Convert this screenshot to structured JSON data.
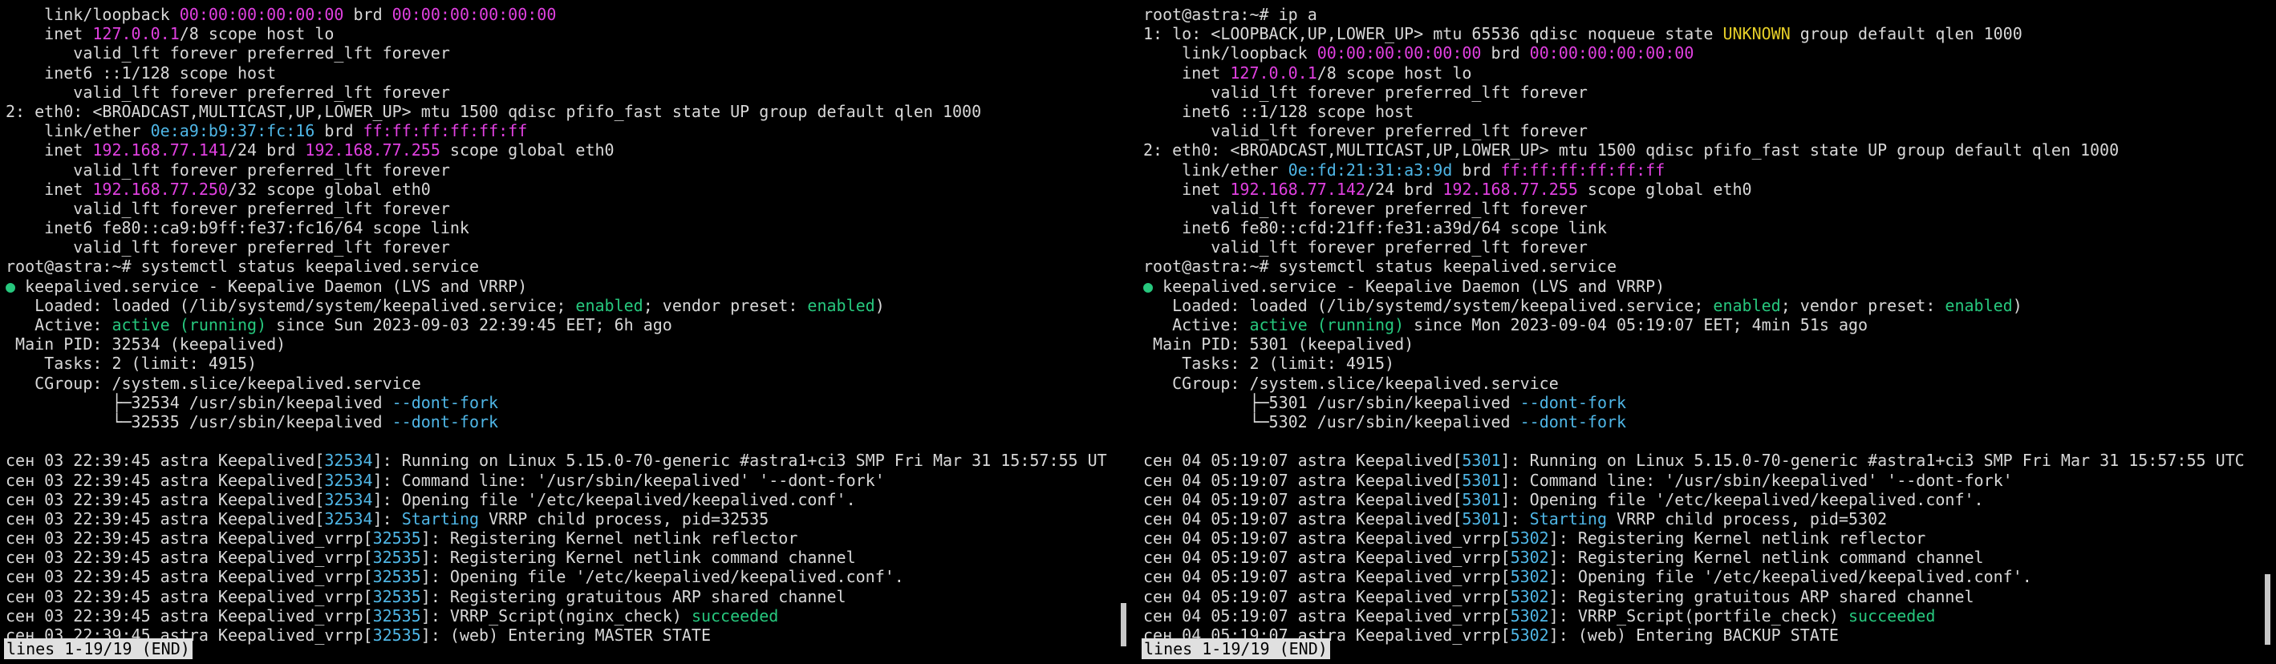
{
  "colors": {
    "magenta": "#e040e0",
    "cyan": "#4fb6e6",
    "green": "#27c87e",
    "yellow": "#e6cf28",
    "status_bg": "#e0e0e0",
    "background": "#000000"
  },
  "panes": [
    {
      "lines": [
        [
          [
            "    link/loopback ",
            ""
          ],
          [
            "00:00:00:00:00:00",
            "mag"
          ],
          [
            " brd ",
            ""
          ],
          [
            "00:00:00:00:00:00",
            "mag"
          ]
        ],
        [
          [
            "    inet ",
            ""
          ],
          [
            "127.0.0.1",
            "mag"
          ],
          [
            "/8 scope host lo",
            ""
          ]
        ],
        [
          [
            "       valid_lft forever preferred_lft forever",
            ""
          ]
        ],
        [
          [
            "    inet6 ::1/128 scope host",
            ""
          ]
        ],
        [
          [
            "       valid_lft forever preferred_lft forever",
            ""
          ]
        ],
        [
          [
            "2: eth0: <BROADCAST,MULTICAST,UP,LOWER_UP> mtu 1500 qdisc pfifo_fast state UP group default qlen 1000",
            ""
          ]
        ],
        [
          [
            "    link/ether ",
            ""
          ],
          [
            "0e:a9:b9:37:fc:16",
            "cyan"
          ],
          [
            " brd ",
            ""
          ],
          [
            "ff:ff:ff:ff:ff:ff",
            "mag"
          ]
        ],
        [
          [
            "    inet ",
            ""
          ],
          [
            "192.168.77.141",
            "mag"
          ],
          [
            "/24 brd ",
            ""
          ],
          [
            "192.168.77.255",
            "mag"
          ],
          [
            " scope global eth0",
            ""
          ]
        ],
        [
          [
            "       valid_lft forever preferred_lft forever",
            ""
          ]
        ],
        [
          [
            "    inet ",
            ""
          ],
          [
            "192.168.77.250",
            "mag"
          ],
          [
            "/32 scope global eth0",
            ""
          ]
        ],
        [
          [
            "       valid_lft forever preferred_lft forever",
            ""
          ]
        ],
        [
          [
            "    inet6 fe80::ca9:b9ff:fe37:fc16/64 scope link",
            ""
          ]
        ],
        [
          [
            "       valid_lft forever preferred_lft forever",
            ""
          ]
        ],
        [
          [
            "root@astra:~# systemctl status keepalived.service",
            ""
          ]
        ],
        [
          [
            "●",
            "grn"
          ],
          [
            " keepalived.service - Keepalive Daemon (LVS and VRRP)",
            ""
          ]
        ],
        [
          [
            "   Loaded: loaded (/lib/systemd/system/keepalived.service; ",
            ""
          ],
          [
            "enabled",
            "grn"
          ],
          [
            "; vendor preset: ",
            ""
          ],
          [
            "enabled",
            "grn"
          ],
          [
            ")",
            ""
          ]
        ],
        [
          [
            "   Active: ",
            ""
          ],
          [
            "active (running)",
            "grn"
          ],
          [
            " since Sun 2023-09-03 22:39:45 EET; 6h ago",
            ""
          ]
        ],
        [
          [
            " Main PID: 32534 (keepalived)",
            ""
          ]
        ],
        [
          [
            "    Tasks: 2 (limit: 4915)",
            ""
          ]
        ],
        [
          [
            "   CGroup: /system.slice/keepalived.service",
            ""
          ]
        ],
        [
          [
            "           ├─32534 /usr/sbin/keepalived ",
            ""
          ],
          [
            "--dont-fork",
            "cyan"
          ]
        ],
        [
          [
            "           └─32535 /usr/sbin/keepalived ",
            ""
          ],
          [
            "--dont-fork",
            "cyan"
          ]
        ],
        [],
        [
          [
            "сен 03 22:39:45 astra Keepalived[",
            ""
          ],
          [
            "32534",
            "cyan"
          ],
          [
            "]: Running on Linux 5.15.0-70-generic #astra1+ci3 SMP Fri Mar 31 15:57:55 UT",
            ""
          ]
        ],
        [
          [
            "сен 03 22:39:45 astra Keepalived[",
            ""
          ],
          [
            "32534",
            "cyan"
          ],
          [
            "]: Command line: '/usr/sbin/keepalived' '--dont-fork'",
            ""
          ]
        ],
        [
          [
            "сен 03 22:39:45 astra Keepalived[",
            ""
          ],
          [
            "32534",
            "cyan"
          ],
          [
            "]: Opening file '/etc/keepalived/keepalived.conf'.",
            ""
          ]
        ],
        [
          [
            "сен 03 22:39:45 astra Keepalived[",
            ""
          ],
          [
            "32534",
            "cyan"
          ],
          [
            "]: ",
            ""
          ],
          [
            "Starting",
            "cyan"
          ],
          [
            " VRRP child process, pid=32535",
            ""
          ]
        ],
        [
          [
            "сен 03 22:39:45 astra Keepalived_vrrp[",
            ""
          ],
          [
            "32535",
            "cyan"
          ],
          [
            "]: Registering Kernel netlink reflector",
            ""
          ]
        ],
        [
          [
            "сен 03 22:39:45 astra Keepalived_vrrp[",
            ""
          ],
          [
            "32535",
            "cyan"
          ],
          [
            "]: Registering Kernel netlink command channel",
            ""
          ]
        ],
        [
          [
            "сен 03 22:39:45 astra Keepalived_vrrp[",
            ""
          ],
          [
            "32535",
            "cyan"
          ],
          [
            "]: Opening file '/etc/keepalived/keepalived.conf'.",
            ""
          ]
        ],
        [
          [
            "сен 03 22:39:45 astra Keepalived_vrrp[",
            ""
          ],
          [
            "32535",
            "cyan"
          ],
          [
            "]: Registering gratuitous ARP shared channel",
            ""
          ]
        ],
        [
          [
            "сен 03 22:39:45 astra Keepalived_vrrp[",
            ""
          ],
          [
            "32535",
            "cyan"
          ],
          [
            "]: VRRP_Script(nginx_check) ",
            ""
          ],
          [
            "succeeded",
            "grn"
          ]
        ],
        [
          [
            "сен 03 22:39:45 astra Keepalived_vrrp[",
            ""
          ],
          [
            "32535",
            "cyan"
          ],
          [
            "]: (web) Entering MASTER STATE",
            ""
          ]
        ]
      ],
      "status": "lines 1-19/19 (END)"
    },
    {
      "lines": [
        [
          [
            "root@astra:~# ip a",
            ""
          ]
        ],
        [
          [
            "1: lo: <LOOPBACK,UP,LOWER_UP> mtu 65536 qdisc noqueue state ",
            ""
          ],
          [
            "UNKNOWN",
            "yel"
          ],
          [
            " group default qlen 1000",
            ""
          ]
        ],
        [
          [
            "    link/loopback ",
            ""
          ],
          [
            "00:00:00:00:00:00",
            "mag"
          ],
          [
            " brd ",
            ""
          ],
          [
            "00:00:00:00:00:00",
            "mag"
          ]
        ],
        [
          [
            "    inet ",
            ""
          ],
          [
            "127.0.0.1",
            "mag"
          ],
          [
            "/8 scope host lo",
            ""
          ]
        ],
        [
          [
            "       valid_lft forever preferred_lft forever",
            ""
          ]
        ],
        [
          [
            "    inet6 ::1/128 scope host",
            ""
          ]
        ],
        [
          [
            "       valid_lft forever preferred_lft forever",
            ""
          ]
        ],
        [
          [
            "2: eth0: <BROADCAST,MULTICAST,UP,LOWER_UP> mtu 1500 qdisc pfifo_fast state UP group default qlen 1000",
            ""
          ]
        ],
        [
          [
            "    link/ether ",
            ""
          ],
          [
            "0e:fd:21:31:a3:9d",
            "cyan"
          ],
          [
            " brd ",
            ""
          ],
          [
            "ff:ff:ff:ff:ff:ff",
            "mag"
          ]
        ],
        [
          [
            "    inet ",
            ""
          ],
          [
            "192.168.77.142",
            "mag"
          ],
          [
            "/24 brd ",
            ""
          ],
          [
            "192.168.77.255",
            "mag"
          ],
          [
            " scope global eth0",
            ""
          ]
        ],
        [
          [
            "       valid_lft forever preferred_lft forever",
            ""
          ]
        ],
        [
          [
            "    inet6 fe80::cfd:21ff:fe31:a39d/64 scope link",
            ""
          ]
        ],
        [
          [
            "       valid_lft forever preferred_lft forever",
            ""
          ]
        ],
        [
          [
            "root@astra:~# systemctl status keepalived.service",
            ""
          ]
        ],
        [
          [
            "●",
            "grn"
          ],
          [
            " keepalived.service - Keepalive Daemon (LVS and VRRP)",
            ""
          ]
        ],
        [
          [
            "   Loaded: loaded (/lib/systemd/system/keepalived.service; ",
            ""
          ],
          [
            "enabled",
            "grn"
          ],
          [
            "; vendor preset: ",
            ""
          ],
          [
            "enabled",
            "grn"
          ],
          [
            ")",
            ""
          ]
        ],
        [
          [
            "   Active: ",
            ""
          ],
          [
            "active (running)",
            "grn"
          ],
          [
            " since Mon 2023-09-04 05:19:07 EET; 4min 51s ago",
            ""
          ]
        ],
        [
          [
            " Main PID: 5301 (keepalived)",
            ""
          ]
        ],
        [
          [
            "    Tasks: 2 (limit: 4915)",
            ""
          ]
        ],
        [
          [
            "   CGroup: /system.slice/keepalived.service",
            ""
          ]
        ],
        [
          [
            "           ├─5301 /usr/sbin/keepalived ",
            ""
          ],
          [
            "--dont-fork",
            "cyan"
          ]
        ],
        [
          [
            "           └─5302 /usr/sbin/keepalived ",
            ""
          ],
          [
            "--dont-fork",
            "cyan"
          ]
        ],
        [],
        [
          [
            "сен 04 05:19:07 astra Keepalived[",
            ""
          ],
          [
            "5301",
            "cyan"
          ],
          [
            "]: Running on Linux 5.15.0-70-generic #astra1+ci3 SMP Fri Mar 31 15:57:55 UTC",
            ""
          ]
        ],
        [
          [
            "сен 04 05:19:07 astra Keepalived[",
            ""
          ],
          [
            "5301",
            "cyan"
          ],
          [
            "]: Command line: '/usr/sbin/keepalived' '--dont-fork'",
            ""
          ]
        ],
        [
          [
            "сен 04 05:19:07 astra Keepalived[",
            ""
          ],
          [
            "5301",
            "cyan"
          ],
          [
            "]: Opening file '/etc/keepalived/keepalived.conf'.",
            ""
          ]
        ],
        [
          [
            "сен 04 05:19:07 astra Keepalived[",
            ""
          ],
          [
            "5301",
            "cyan"
          ],
          [
            "]: ",
            ""
          ],
          [
            "Starting",
            "cyan"
          ],
          [
            " VRRP child process, pid=5302",
            ""
          ]
        ],
        [
          [
            "сен 04 05:19:07 astra Keepalived_vrrp[",
            ""
          ],
          [
            "5302",
            "cyan"
          ],
          [
            "]: Registering Kernel netlink reflector",
            ""
          ]
        ],
        [
          [
            "сен 04 05:19:07 astra Keepalived_vrrp[",
            ""
          ],
          [
            "5302",
            "cyan"
          ],
          [
            "]: Registering Kernel netlink command channel",
            ""
          ]
        ],
        [
          [
            "сен 04 05:19:07 astra Keepalived_vrrp[",
            ""
          ],
          [
            "5302",
            "cyan"
          ],
          [
            "]: Opening file '/etc/keepalived/keepalived.conf'.",
            ""
          ]
        ],
        [
          [
            "сен 04 05:19:07 astra Keepalived_vrrp[",
            ""
          ],
          [
            "5302",
            "cyan"
          ],
          [
            "]: Registering gratuitous ARP shared channel",
            ""
          ]
        ],
        [
          [
            "сен 04 05:19:07 astra Keepalived_vrrp[",
            ""
          ],
          [
            "5302",
            "cyan"
          ],
          [
            "]: VRRP_Script(portfile_check) ",
            ""
          ],
          [
            "succeeded",
            "grn"
          ]
        ],
        [
          [
            "сен 04 05:19:07 astra Keepalived_vrrp[",
            ""
          ],
          [
            "5302",
            "cyan"
          ],
          [
            "]: (web) Entering BACKUP STATE",
            ""
          ]
        ]
      ],
      "status": "lines 1-19/19 (END)"
    }
  ]
}
